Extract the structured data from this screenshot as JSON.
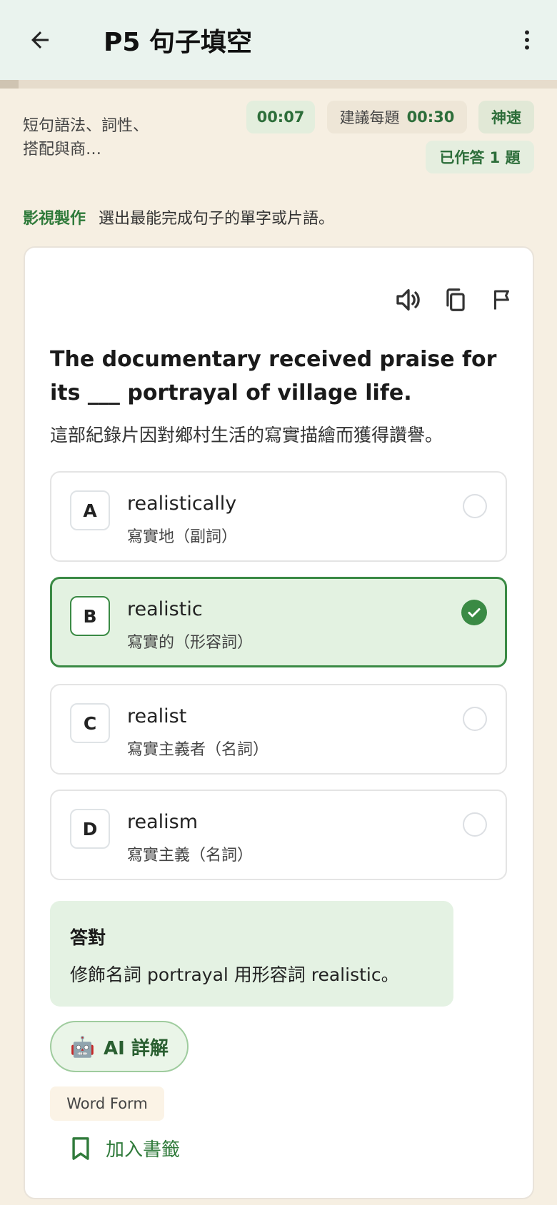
{
  "app_bar": {
    "title": "P5 句子填空",
    "back_icon": "arrow-left-icon",
    "more_icon": "more-vertical-icon"
  },
  "progress": {
    "fraction": 0.033
  },
  "meta": {
    "topic": "短句語法、詞性、搭配與商…",
    "timer": "00:07",
    "suggest_label": "建議每題",
    "suggest_time": "00:30",
    "speed": "神速",
    "answered": "已作答 1 題"
  },
  "instruction": {
    "category": "影視製作",
    "text": "選出最能完成句子的單字或片語。"
  },
  "tools": [
    "speaker-icon",
    "copy-icon",
    "flag-icon"
  ],
  "question": {
    "text": "The documentary received praise for its ___ portrayal of village life.",
    "translation": "這部紀錄片因對鄉村生活的寫實描繪而獲得讚譽。"
  },
  "options": [
    {
      "letter": "A",
      "word": "realistically",
      "pos": "寫實地（副詞）",
      "selected": false
    },
    {
      "letter": "B",
      "word": "realistic",
      "pos": "寫實的（形容詞）",
      "selected": true
    },
    {
      "letter": "C",
      "word": "realist",
      "pos": "寫實主義者（名詞）",
      "selected": false
    },
    {
      "letter": "D",
      "word": "realism",
      "pos": "寫實主義（名詞）",
      "selected": false
    }
  ],
  "feedback": {
    "title": "答對",
    "text": "修飾名詞 portrayal 用形容詞 realistic。"
  },
  "ai_button": {
    "icon": "robot-icon",
    "label": "AI 詳解"
  },
  "tag": "Word Form",
  "bookmark": {
    "icon": "bookmark-icon",
    "label": "加入書籤"
  },
  "colors": {
    "accent": "#3a8a44",
    "background": "#f6efe2",
    "app_bar": "#eaf3ee"
  }
}
